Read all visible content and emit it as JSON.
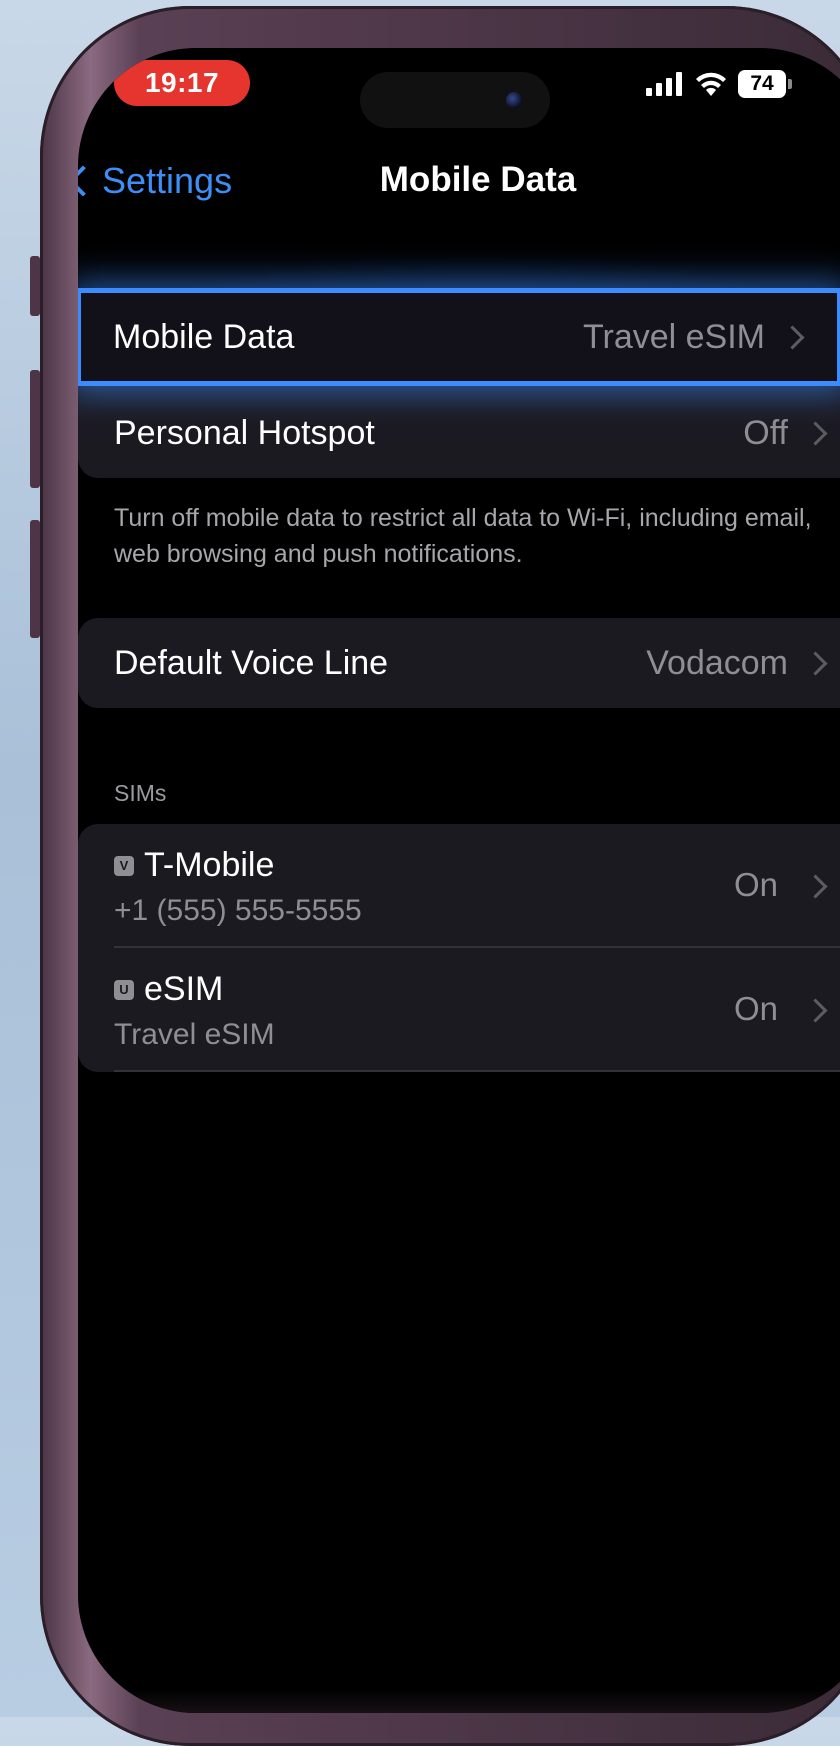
{
  "status_bar": {
    "time": "19:17",
    "battery_level": "74",
    "icons": [
      "cellular-signal-icon",
      "wifi-icon",
      "battery-icon"
    ]
  },
  "nav": {
    "back_label": "Settings",
    "title": "Mobile Data"
  },
  "group1": {
    "rows": [
      {
        "label": "Mobile Data",
        "value": "Travel eSIM"
      },
      {
        "label": "Personal Hotspot",
        "value": "Off"
      }
    ],
    "highlight_color": "#3c8cff"
  },
  "footnote": "Turn off mobile data to restrict all data to Wi-Fi, including email, web browsing and push notifications.",
  "voice_line": {
    "label": "Default Voice Line",
    "value": "Vodacom"
  },
  "sims": {
    "header": "SIMs",
    "items": [
      {
        "badge": "V",
        "name": "T-Mobile",
        "subtitle": "+1 (555) 555-5555",
        "status": "On"
      },
      {
        "badge": "U",
        "name": "eSIM",
        "subtitle": "Travel eSIM",
        "status": "On"
      }
    ]
  }
}
